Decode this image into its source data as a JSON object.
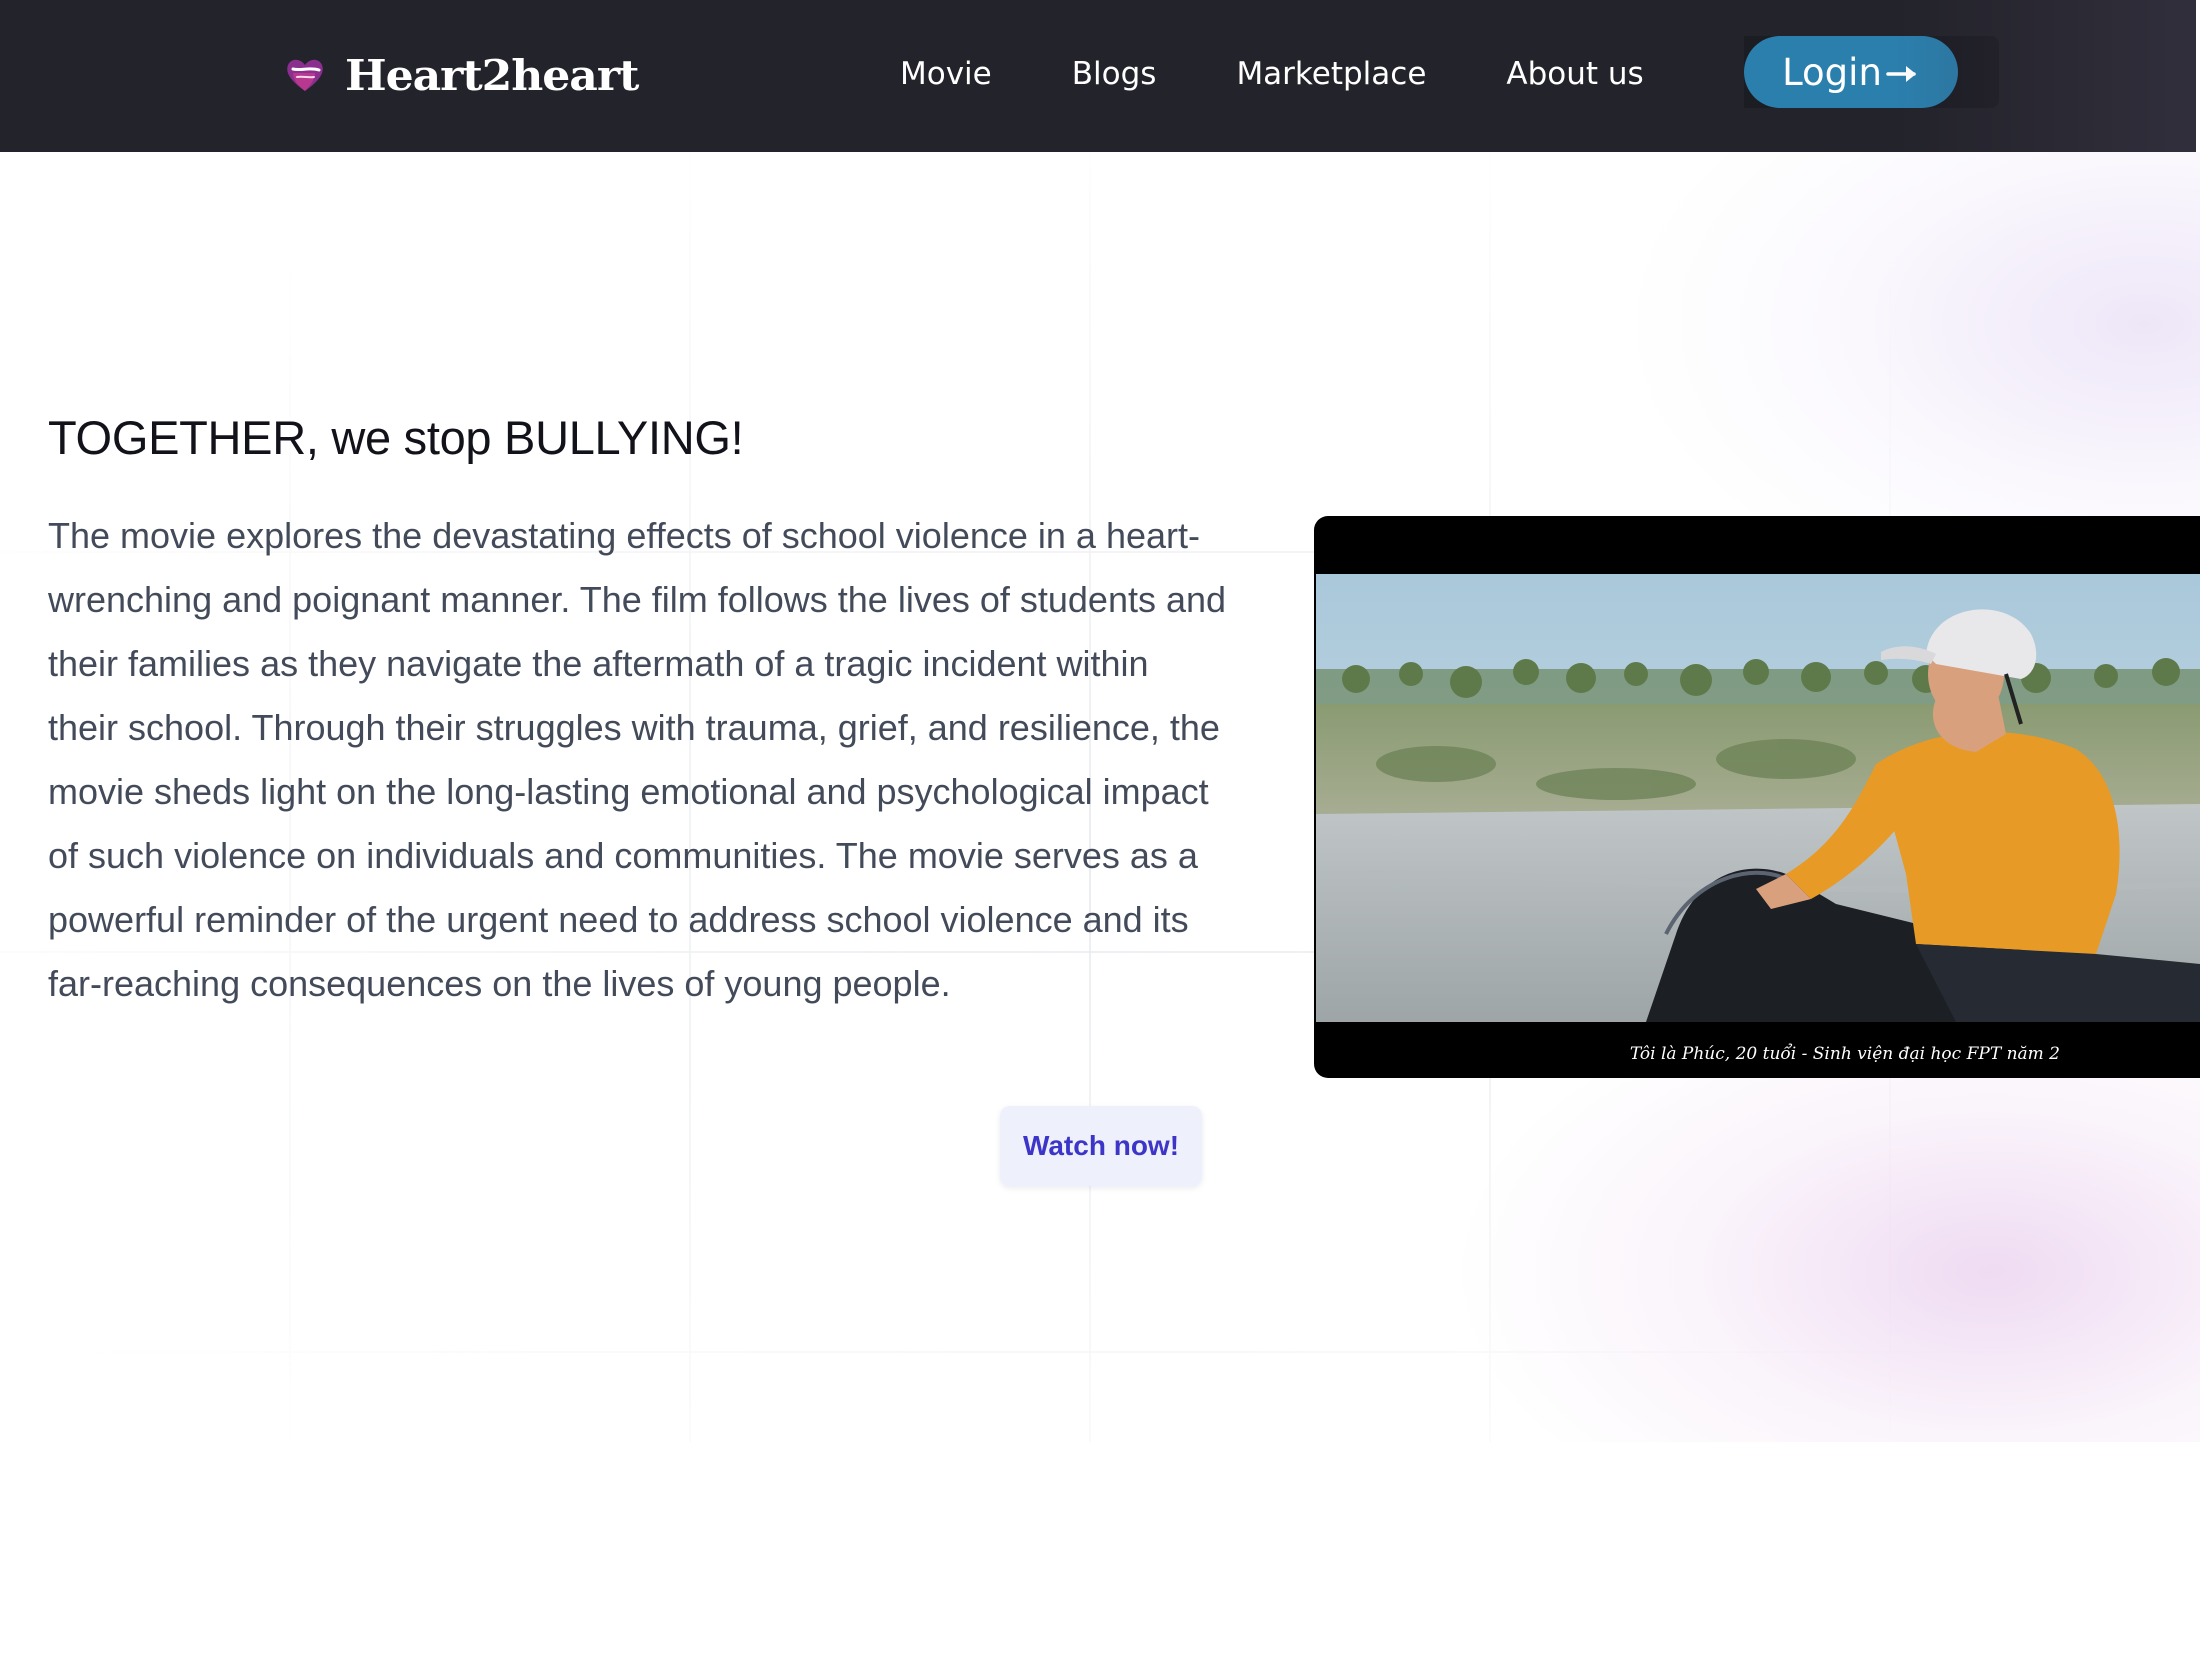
{
  "header": {
    "brand_name": "Heart2heart",
    "logo_icon": "heart-logo-icon",
    "nav_items": [
      {
        "label": "Movie"
      },
      {
        "label": "Blogs"
      },
      {
        "label": "Marketplace"
      },
      {
        "label": "About us"
      }
    ],
    "login_label": "Login",
    "login_icon": "arrow-right-icon"
  },
  "hero": {
    "title": "TOGETHER, we stop BULLYING!",
    "description": "The movie explores the devastating effects of school violence in a heart-wrenching and poignant manner. The film follows the lives of students and their families as they navigate the aftermath of a tragic incident within their school. Through their struggles with trauma, grief, and resilience, the movie sheds light on the long-lasting emotional and psychological impact of such violence on individuals and communities. The movie serves as a powerful reminder of the urgent need to address school violence and its far-reaching consequences on the lives of young people.",
    "watch_button_label": "Watch now!"
  },
  "video": {
    "subtitle": "Tôi là Phúc, 20 tuổi - Sinh viện đại học FPT năm 2"
  },
  "colors": {
    "navbar_bg": "#23232b",
    "login_bg": "#2b7fad",
    "watch_text": "#3c35c8",
    "watch_bg": "#eef0fc",
    "logo_heart": "#8a2f8e"
  }
}
